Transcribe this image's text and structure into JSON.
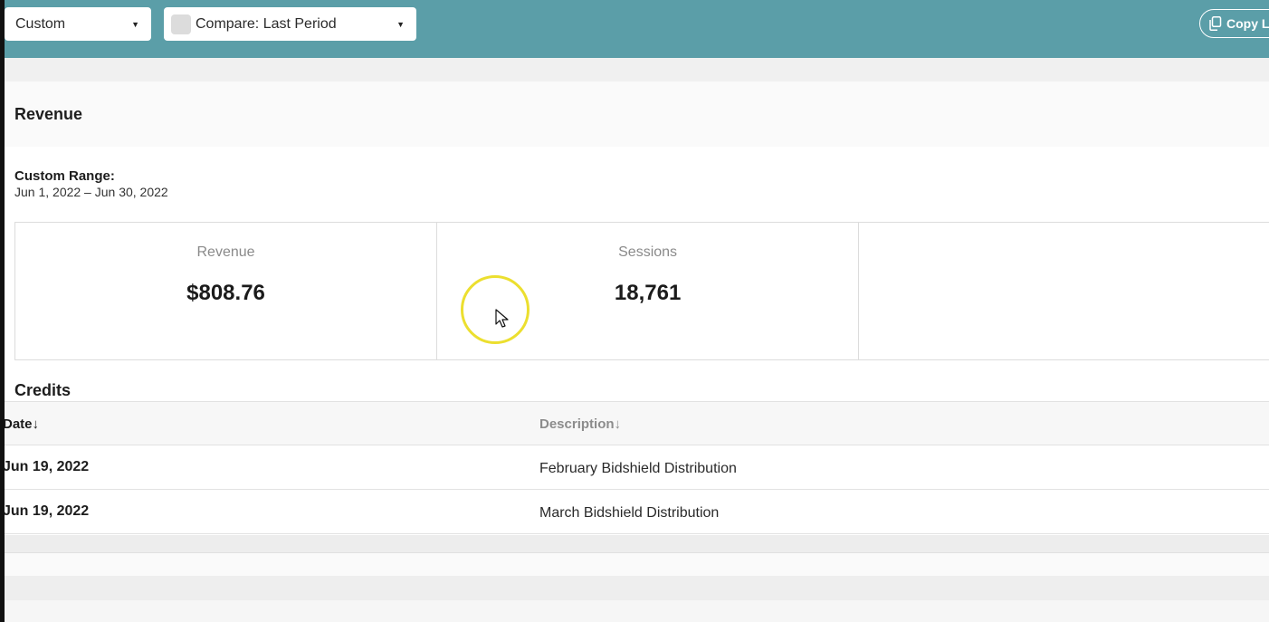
{
  "toolbar": {
    "range_select": "Custom",
    "compare_select": "Compare: Last Period",
    "copy_button": "Copy L"
  },
  "revenue_section": {
    "title": "Revenue",
    "range_label": "Custom Range:",
    "range_dates": "Jun 1, 2022 – Jun 30, 2022"
  },
  "metrics": [
    {
      "label": "Revenue",
      "value": "$808.76"
    },
    {
      "label": "Sessions",
      "value": "18,761"
    },
    {
      "label": "",
      "value": ""
    }
  ],
  "credits": {
    "title": "Credits",
    "columns": {
      "date": "Date↓",
      "description": "Description↓"
    },
    "rows": [
      {
        "date": "Jun 19, 2022",
        "description": "February Bidshield Distribution"
      },
      {
        "date": "Jun 19, 2022",
        "description": "March Bidshield Distribution"
      }
    ]
  },
  "colors": {
    "topbar": "#5b9ea8",
    "cursor_ring": "#ecdf2f"
  }
}
